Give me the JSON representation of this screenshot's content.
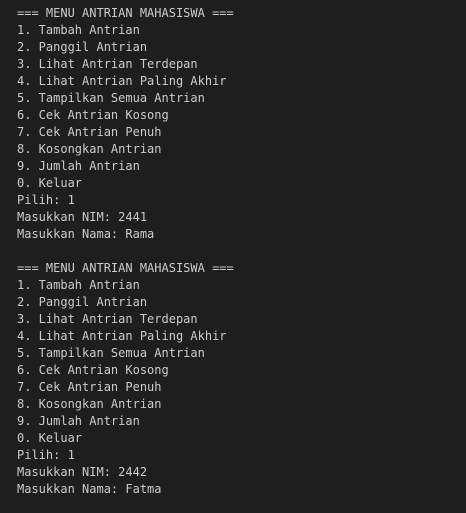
{
  "colors": {
    "background": "#1e1e1e",
    "text": "#cccccc"
  },
  "terminal": {
    "sessions": [
      {
        "menu_title": "=== MENU ANTRIAN MAHASISWA ===",
        "options": [
          "1. Tambah Antrian",
          "2. Panggil Antrian",
          "3. Lihat Antrian Terdepan",
          "4. Lihat Antrian Paling Akhir",
          "5. Tampilkan Semua Antrian",
          "6. Cek Antrian Kosong",
          "7. Cek Antrian Penuh",
          "8. Kosongkan Antrian",
          "9. Jumlah Antrian",
          "0. Keluar"
        ],
        "choice": "Pilih: 1",
        "nim": "Masukkan NIM: 2441",
        "name": "Masukkan Nama: Rama"
      },
      {
        "menu_title": "=== MENU ANTRIAN MAHASISWA ===",
        "options": [
          "1. Tambah Antrian",
          "2. Panggil Antrian",
          "3. Lihat Antrian Terdepan",
          "4. Lihat Antrian Paling Akhir",
          "5. Tampilkan Semua Antrian",
          "6. Cek Antrian Kosong",
          "7. Cek Antrian Penuh",
          "8. Kosongkan Antrian",
          "9. Jumlah Antrian",
          "0. Keluar"
        ],
        "choice": "Pilih: 1",
        "nim": "Masukkan NIM: 2442",
        "name": "Masukkan Nama: Fatma"
      }
    ]
  }
}
